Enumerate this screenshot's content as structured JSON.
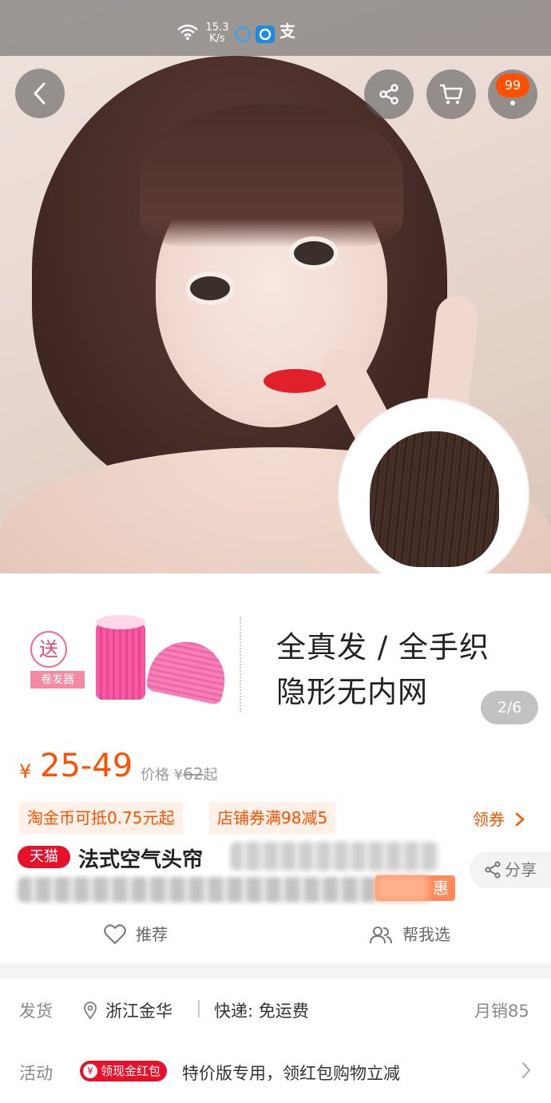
{
  "status_bar": {
    "net_speed": "15.3",
    "net_unit": "K/s",
    "app_icon": "支"
  },
  "header": {
    "cart_badge": "99"
  },
  "gallery": {
    "gift_badge": "送",
    "gift_label": "卷发器",
    "feature_line1": "全真发 / 全手织",
    "feature_line2": "隐形无内网",
    "pager": "2/6"
  },
  "price": {
    "currency": "¥",
    "range": "25-49",
    "orig_prefix": "价格",
    "orig_currency": "¥",
    "orig_value": "62",
    "orig_suffix": "起"
  },
  "coupons": {
    "coin": "淘金币可抵0.75元起",
    "shop": "店铺券满98减5",
    "get": "领券"
  },
  "title": {
    "badge": "天猫",
    "text": "法式空气头帘",
    "promo_tail": "惠",
    "share": "分享"
  },
  "actions": {
    "recommend": "推荐",
    "help_choose": "帮我选"
  },
  "shipping": {
    "label": "发货",
    "location": "浙江金华",
    "express": "快递: 免运费",
    "sales": "月销85"
  },
  "activity": {
    "label": "活动",
    "tag": "领现金红包",
    "text": "特价版专用，领红包购物立减"
  },
  "colors": {
    "accent": "#ff5000",
    "tmall_red": "#e8112b"
  }
}
